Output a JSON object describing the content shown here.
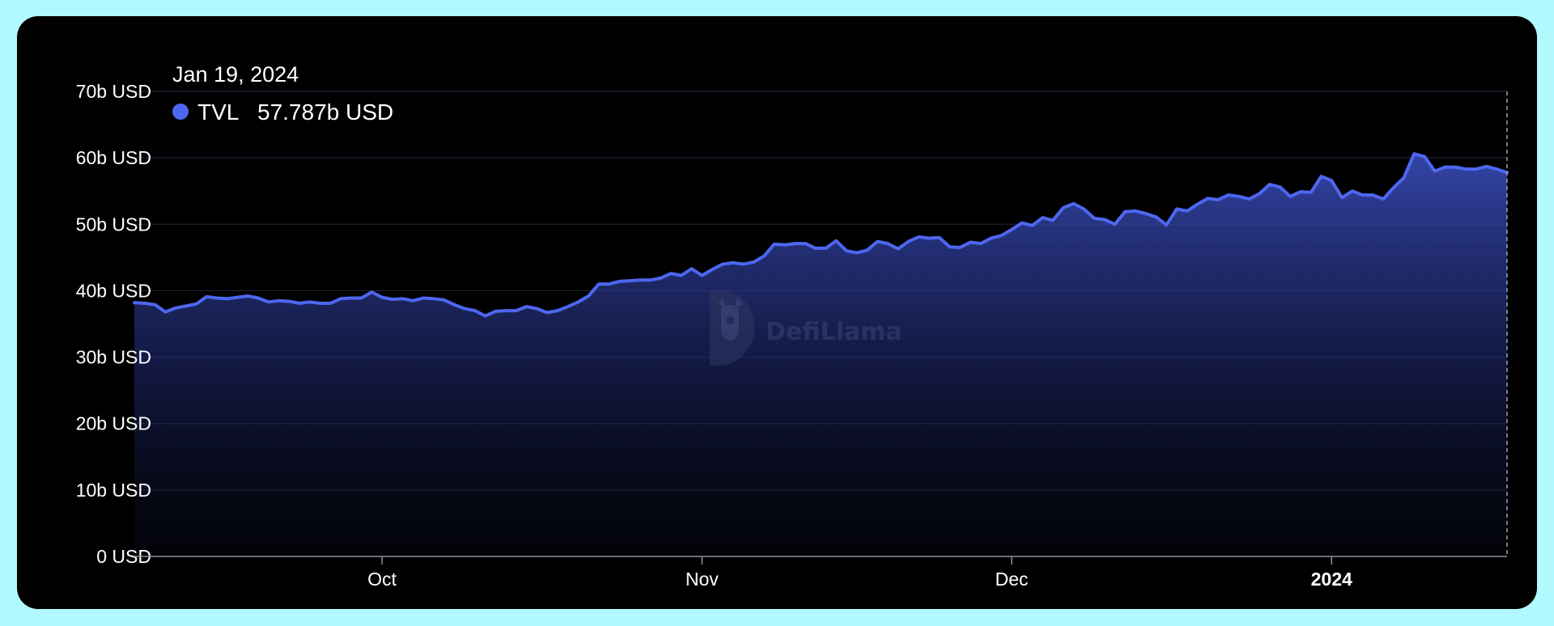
{
  "chart_data": {
    "type": "area",
    "title": "",
    "xlabel": "",
    "ylabel": "",
    "ylim": [
      0,
      70
    ],
    "y_ticks": [
      "0 USD",
      "10b USD",
      "20b USD",
      "30b USD",
      "40b USD",
      "50b USD",
      "60b USD",
      "70b USD"
    ],
    "x_ticks": [
      {
        "label": "Oct",
        "date": "2023-10-01",
        "bold": false
      },
      {
        "label": "Nov",
        "date": "2023-11-01",
        "bold": false
      },
      {
        "label": "Dec",
        "date": "2023-12-01",
        "bold": false
      },
      {
        "label": "2024",
        "date": "2024-01-01",
        "bold": true
      }
    ],
    "grid": true,
    "series": [
      {
        "name": "TVL",
        "color": "#4d67f0",
        "values": [
          [
            "2023-09-07",
            38.2
          ],
          [
            "2023-09-08",
            38.1
          ],
          [
            "2023-09-09",
            37.9
          ],
          [
            "2023-09-10",
            36.8
          ],
          [
            "2023-09-11",
            37.4
          ],
          [
            "2023-09-12",
            37.7
          ],
          [
            "2023-09-13",
            38.0
          ],
          [
            "2023-09-14",
            39.1
          ],
          [
            "2023-09-15",
            38.9
          ],
          [
            "2023-09-16",
            38.8
          ],
          [
            "2023-09-17",
            39.0
          ],
          [
            "2023-09-18",
            39.2
          ],
          [
            "2023-09-19",
            38.9
          ],
          [
            "2023-09-20",
            38.3
          ],
          [
            "2023-09-21",
            38.5
          ],
          [
            "2023-09-22",
            38.4
          ],
          [
            "2023-09-23",
            38.1
          ],
          [
            "2023-09-24",
            38.3
          ],
          [
            "2023-09-25",
            38.1
          ],
          [
            "2023-09-26",
            38.1
          ],
          [
            "2023-09-27",
            38.8
          ],
          [
            "2023-09-28",
            38.9
          ],
          [
            "2023-09-29",
            38.9
          ],
          [
            "2023-09-30",
            39.8
          ],
          [
            "2023-10-01",
            39.0
          ],
          [
            "2023-10-02",
            38.7
          ],
          [
            "2023-10-03",
            38.8
          ],
          [
            "2023-10-04",
            38.5
          ],
          [
            "2023-10-05",
            38.9
          ],
          [
            "2023-10-06",
            38.8
          ],
          [
            "2023-10-07",
            38.6
          ],
          [
            "2023-10-08",
            37.9
          ],
          [
            "2023-10-09",
            37.3
          ],
          [
            "2023-10-10",
            37.0
          ],
          [
            "2023-10-11",
            36.2
          ],
          [
            "2023-10-12",
            36.9
          ],
          [
            "2023-10-13",
            37.0
          ],
          [
            "2023-10-14",
            37.0
          ],
          [
            "2023-10-15",
            37.6
          ],
          [
            "2023-10-16",
            37.3
          ],
          [
            "2023-10-17",
            36.7
          ],
          [
            "2023-10-18",
            37.0
          ],
          [
            "2023-10-19",
            37.6
          ],
          [
            "2023-10-20",
            38.3
          ],
          [
            "2023-10-21",
            39.2
          ],
          [
            "2023-10-22",
            41.0
          ],
          [
            "2023-10-23",
            41.0
          ],
          [
            "2023-10-24",
            41.4
          ],
          [
            "2023-10-25",
            41.5
          ],
          [
            "2023-10-26",
            41.6
          ],
          [
            "2023-10-27",
            41.6
          ],
          [
            "2023-10-28",
            41.9
          ],
          [
            "2023-10-29",
            42.6
          ],
          [
            "2023-10-30",
            42.3
          ],
          [
            "2023-10-31",
            43.3
          ],
          [
            "2023-11-01",
            42.3
          ],
          [
            "2023-11-02",
            43.2
          ],
          [
            "2023-11-03",
            44.0
          ],
          [
            "2023-11-04",
            44.2
          ],
          [
            "2023-11-05",
            44.0
          ],
          [
            "2023-11-06",
            44.3
          ],
          [
            "2023-11-07",
            45.2
          ],
          [
            "2023-11-08",
            47.0
          ],
          [
            "2023-11-09",
            46.9
          ],
          [
            "2023-11-10",
            47.1
          ],
          [
            "2023-11-11",
            47.1
          ],
          [
            "2023-11-12",
            46.4
          ],
          [
            "2023-11-13",
            46.4
          ],
          [
            "2023-11-14",
            47.5
          ],
          [
            "2023-11-15",
            46.0
          ],
          [
            "2023-11-16",
            45.7
          ],
          [
            "2023-11-17",
            46.1
          ],
          [
            "2023-11-18",
            47.4
          ],
          [
            "2023-11-19",
            47.1
          ],
          [
            "2023-11-20",
            46.3
          ],
          [
            "2023-11-21",
            47.4
          ],
          [
            "2023-11-22",
            48.1
          ],
          [
            "2023-11-23",
            47.9
          ],
          [
            "2023-11-24",
            48.0
          ],
          [
            "2023-11-25",
            46.6
          ],
          [
            "2023-11-26",
            46.5
          ],
          [
            "2023-11-27",
            47.3
          ],
          [
            "2023-11-28",
            47.1
          ],
          [
            "2023-11-29",
            47.9
          ],
          [
            "2023-11-30",
            48.3
          ],
          [
            "2023-12-01",
            49.2
          ],
          [
            "2023-12-02",
            50.2
          ],
          [
            "2023-12-03",
            49.8
          ],
          [
            "2023-12-04",
            51.0
          ],
          [
            "2023-12-05",
            50.6
          ],
          [
            "2023-12-06",
            52.5
          ],
          [
            "2023-12-07",
            53.1
          ],
          [
            "2023-12-08",
            52.3
          ],
          [
            "2023-12-09",
            50.9
          ],
          [
            "2023-12-10",
            50.7
          ],
          [
            "2023-12-11",
            50.0
          ],
          [
            "2023-12-12",
            51.9
          ],
          [
            "2023-12-13",
            52.0
          ],
          [
            "2023-12-14",
            51.6
          ],
          [
            "2023-12-15",
            51.1
          ],
          [
            "2023-12-16",
            49.9
          ],
          [
            "2023-12-17",
            52.3
          ],
          [
            "2023-12-18",
            52.0
          ],
          [
            "2023-12-19",
            53.0
          ],
          [
            "2023-12-20",
            53.9
          ],
          [
            "2023-12-21",
            53.7
          ],
          [
            "2023-12-22",
            54.4
          ],
          [
            "2023-12-23",
            54.2
          ],
          [
            "2023-12-24",
            53.8
          ],
          [
            "2023-12-25",
            54.6
          ],
          [
            "2023-12-26",
            56.0
          ],
          [
            "2023-12-27",
            55.6
          ],
          [
            "2023-12-28",
            54.2
          ],
          [
            "2023-12-29",
            54.9
          ],
          [
            "2023-12-30",
            54.8
          ],
          [
            "2023-12-31",
            57.2
          ],
          [
            "2024-01-01",
            56.6
          ],
          [
            "2024-01-02",
            54.0
          ],
          [
            "2024-01-03",
            55.0
          ],
          [
            "2024-01-04",
            54.4
          ],
          [
            "2024-01-05",
            54.4
          ],
          [
            "2024-01-06",
            53.8
          ],
          [
            "2024-01-07",
            55.5
          ],
          [
            "2024-01-08",
            57.0
          ],
          [
            "2024-01-09",
            60.6
          ],
          [
            "2024-01-10",
            60.2
          ],
          [
            "2024-01-11",
            58.0
          ],
          [
            "2024-01-12",
            58.6
          ],
          [
            "2024-01-13",
            58.6
          ],
          [
            "2024-01-14",
            58.3
          ],
          [
            "2024-01-15",
            58.3
          ],
          [
            "2024-01-16",
            58.7
          ],
          [
            "2024-01-17",
            58.3
          ],
          [
            "2024-01-18",
            57.787
          ]
        ]
      }
    ]
  },
  "tooltip": {
    "date": "Jan 19, 2024",
    "series_name": "TVL",
    "value": "57.787b USD",
    "color": "#4d67f0"
  },
  "watermark": {
    "text": "DefiLlama"
  },
  "colors": {
    "page_background": "#b2f9ff",
    "card_background": "#000000",
    "line": "#4d67f0",
    "grid": "#1c2237",
    "axis": "#8a8f9c"
  }
}
